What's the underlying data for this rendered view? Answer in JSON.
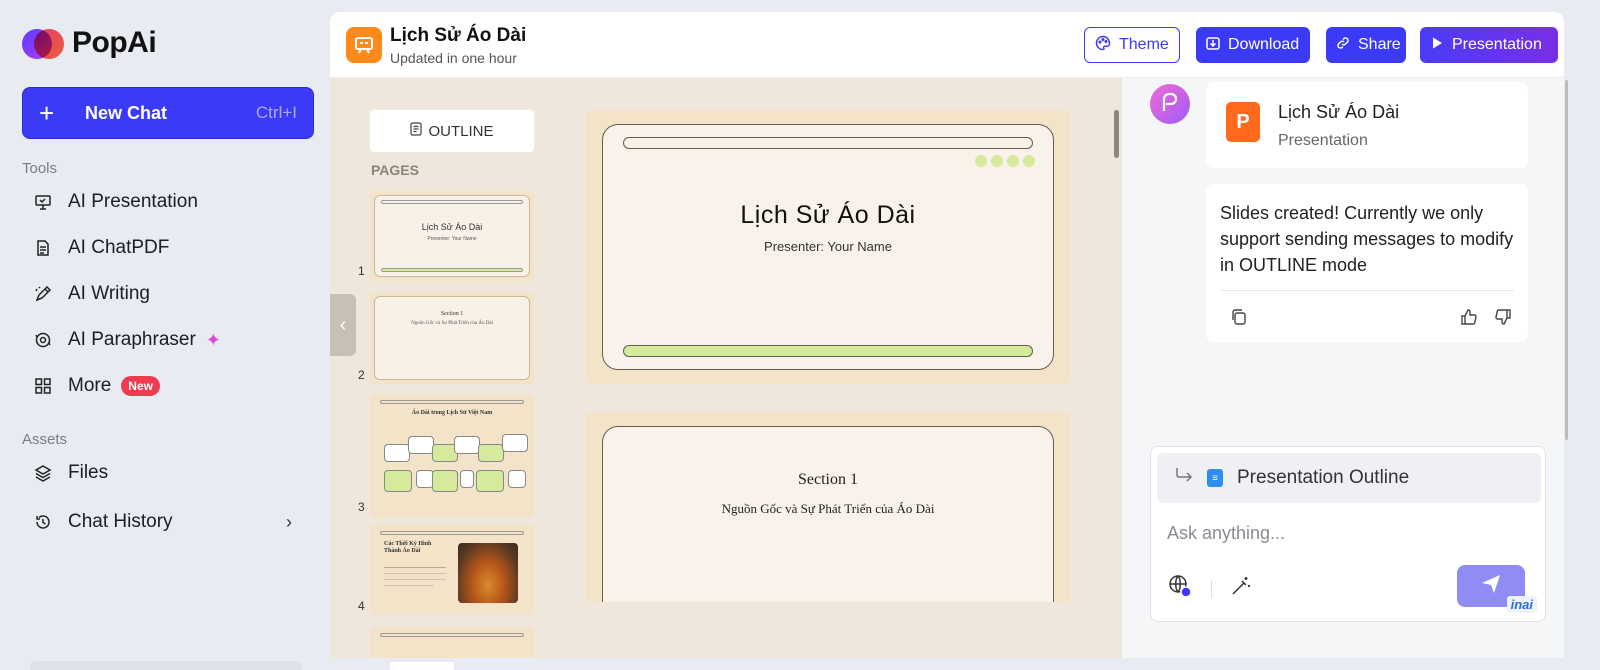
{
  "app": {
    "name": "PopAi"
  },
  "sidebar": {
    "new_chat": {
      "label": "New Chat",
      "shortcut": "Ctrl+I"
    },
    "tools_title": "Tools",
    "tools": [
      {
        "label": "AI Presentation",
        "icon": "presentation-icon"
      },
      {
        "label": "AI ChatPDF",
        "icon": "document-icon"
      },
      {
        "label": "AI Writing",
        "icon": "pen-icon"
      },
      {
        "label": "AI Paraphraser",
        "icon": "paraphrase-icon"
      },
      {
        "label": "More",
        "icon": "grid-icon",
        "badge": "New"
      }
    ],
    "assets_title": "Assets",
    "assets": [
      {
        "label": "Files",
        "icon": "layers-icon"
      },
      {
        "label": "Chat History",
        "icon": "history-icon"
      }
    ]
  },
  "header": {
    "title": "Lịch Sử Áo Dài",
    "subtitle": "Updated in one hour",
    "buttons": {
      "theme": "Theme",
      "download": "Download",
      "share": "Share",
      "presentation": "Presentation"
    }
  },
  "editor": {
    "outline_label": "OUTLINE",
    "pages_label": "PAGES",
    "thumbs": [
      {
        "num": "1",
        "title": "Lịch Sử Áo Dài",
        "sub": "Presenter: Your Name"
      },
      {
        "num": "2",
        "title": "Section 1",
        "sub": "Nguồn Gốc và Sự Phát Triển của Áo Dài"
      },
      {
        "num": "3",
        "title": "Áo Dài trong Lịch Sử Việt Nam"
      },
      {
        "num": "4",
        "title": "Các Thời Kỳ Hình Thành Áo Dài"
      }
    ],
    "slides": [
      {
        "title": "Lịch Sử Áo Dài",
        "subtitle": "Presenter: Your Name"
      },
      {
        "title": "Section 1",
        "subtitle": "Nguồn Gốc và Sự Phát Triển của Áo Dài"
      }
    ]
  },
  "chat": {
    "attachment": {
      "title": "Lịch Sử Áo Dài",
      "type": "Presentation",
      "icon_letter": "P"
    },
    "message": "Slides created! Currently we only support sending messages to modify in OUTLINE mode",
    "reference_chip": "Presentation Outline",
    "input_placeholder": "Ask anything...",
    "watermark": "inai"
  }
}
